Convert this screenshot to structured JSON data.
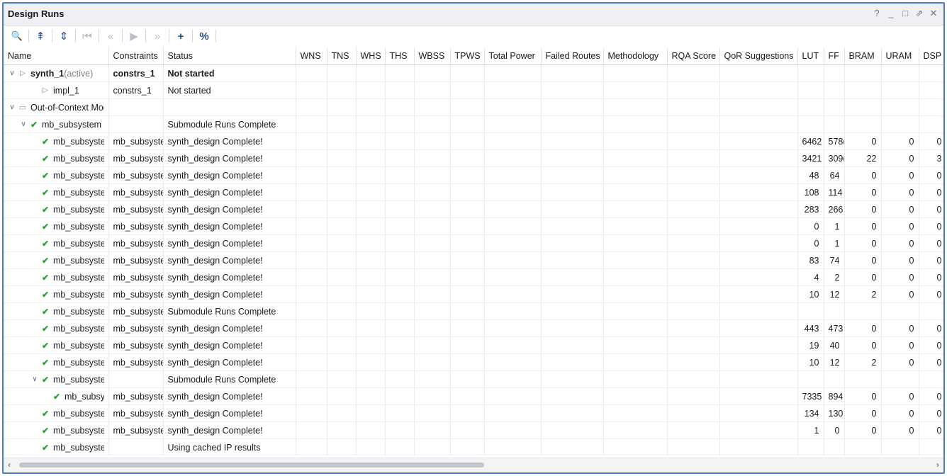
{
  "window": {
    "title": "Design Runs",
    "controls": [
      "?",
      "_",
      "□",
      "⇗",
      "✕"
    ]
  },
  "toolbar": {
    "buttons": [
      {
        "name": "search",
        "glyph": "🔍"
      },
      {
        "name": "collapse-all",
        "glyph": "⇞"
      },
      {
        "name": "expand-all",
        "glyph": "⇕"
      },
      {
        "name": "first",
        "glyph": "⏮"
      },
      {
        "name": "previous",
        "glyph": "«"
      },
      {
        "name": "run",
        "glyph": "▶"
      },
      {
        "name": "next",
        "glyph": "»"
      },
      {
        "name": "add",
        "glyph": "+"
      },
      {
        "name": "percent",
        "glyph": "%"
      }
    ]
  },
  "columns": [
    "Name",
    "Constraints",
    "Status",
    "WNS",
    "TNS",
    "WHS",
    "THS",
    "WBSS",
    "TPWS",
    "Total Power",
    "Failed Routes",
    "Methodology",
    "RQA Score",
    "QoR Suggestions",
    "LUT",
    "FF",
    "BRAM",
    "URAM",
    "DSP"
  ],
  "rows": [
    {
      "indent": 0,
      "exp": "∨",
      "icon": "play",
      "name": "synth_1",
      "suffix": " (active)",
      "constraints": "constrs_1",
      "status": "Not started",
      "bold": true,
      "lut": "",
      "ff": "",
      "bram": "",
      "uram": "",
      "dsp": ""
    },
    {
      "indent": 2,
      "exp": "",
      "icon": "play",
      "name": "impl_1",
      "suffix": "",
      "constraints": "constrs_1",
      "status": "Not started",
      "bold": false,
      "lut": "",
      "ff": "",
      "bram": "",
      "uram": "",
      "dsp": ""
    },
    {
      "indent": 0,
      "exp": "∨",
      "icon": "folder",
      "name": "Out-of-Context Module Runs",
      "suffix": "",
      "constraints": "",
      "status": "",
      "bold": false,
      "lut": "",
      "ff": "",
      "bram": "",
      "uram": "",
      "dsp": ""
    },
    {
      "indent": 1,
      "exp": "∨",
      "icon": "check",
      "name": "mb_subsystem",
      "suffix": "",
      "constraints": "",
      "status": "Submodule Runs Complete",
      "bold": false,
      "lut": "",
      "ff": "",
      "bram": "",
      "uram": "",
      "dsp": ""
    },
    {
      "indent": 2,
      "exp": "",
      "icon": "check",
      "name": "mb_subsystem",
      "suffix": "",
      "constraints": "mb_subsyste",
      "status": "synth_design Complete!",
      "bold": false,
      "lut": "6462",
      "ff": "578(",
      "bram": "0",
      "uram": "0",
      "dsp": "0"
    },
    {
      "indent": 2,
      "exp": "",
      "icon": "check",
      "name": "mb_subsystem",
      "suffix": "",
      "constraints": "mb_subsyste",
      "status": "synth_design Complete!",
      "bold": false,
      "lut": "3421",
      "ff": "309(",
      "bram": "22",
      "uram": "0",
      "dsp": "3"
    },
    {
      "indent": 2,
      "exp": "",
      "icon": "check",
      "name": "mb_subsystem",
      "suffix": "",
      "constraints": "mb_subsyste",
      "status": "synth_design Complete!",
      "bold": false,
      "lut": "48",
      "ff": "64",
      "bram": "0",
      "uram": "0",
      "dsp": "0"
    },
    {
      "indent": 2,
      "exp": "",
      "icon": "check",
      "name": "mb_subsystem",
      "suffix": "",
      "constraints": "mb_subsyste",
      "status": "synth_design Complete!",
      "bold": false,
      "lut": "108",
      "ff": "114",
      "bram": "0",
      "uram": "0",
      "dsp": "0"
    },
    {
      "indent": 2,
      "exp": "",
      "icon": "check",
      "name": "mb_subsystem",
      "suffix": "",
      "constraints": "mb_subsyste",
      "status": "synth_design Complete!",
      "bold": false,
      "lut": "283",
      "ff": "266",
      "bram": "0",
      "uram": "0",
      "dsp": "0"
    },
    {
      "indent": 2,
      "exp": "",
      "icon": "check",
      "name": "mb_subsystem",
      "suffix": "",
      "constraints": "mb_subsyste",
      "status": "synth_design Complete!",
      "bold": false,
      "lut": "0",
      "ff": "1",
      "bram": "0",
      "uram": "0",
      "dsp": "0"
    },
    {
      "indent": 2,
      "exp": "",
      "icon": "check",
      "name": "mb_subsystem",
      "suffix": "",
      "constraints": "mb_subsyste",
      "status": "synth_design Complete!",
      "bold": false,
      "lut": "0",
      "ff": "1",
      "bram": "0",
      "uram": "0",
      "dsp": "0"
    },
    {
      "indent": 2,
      "exp": "",
      "icon": "check",
      "name": "mb_subsystem",
      "suffix": "",
      "constraints": "mb_subsyste",
      "status": "synth_design Complete!",
      "bold": false,
      "lut": "83",
      "ff": "74",
      "bram": "0",
      "uram": "0",
      "dsp": "0"
    },
    {
      "indent": 2,
      "exp": "",
      "icon": "check",
      "name": "mb_subsystem",
      "suffix": "",
      "constraints": "mb_subsyste",
      "status": "synth_design Complete!",
      "bold": false,
      "lut": "4",
      "ff": "2",
      "bram": "0",
      "uram": "0",
      "dsp": "0"
    },
    {
      "indent": 2,
      "exp": "",
      "icon": "check",
      "name": "mb_subsystem",
      "suffix": "",
      "constraints": "mb_subsyste",
      "status": "synth_design Complete!",
      "bold": false,
      "lut": "10",
      "ff": "12",
      "bram": "2",
      "uram": "0",
      "dsp": "0"
    },
    {
      "indent": 2,
      "exp": "",
      "icon": "check",
      "name": "mb_subsystem",
      "suffix": "",
      "constraints": "mb_subsyste",
      "status": "Submodule Runs Complete",
      "bold": false,
      "lut": "",
      "ff": "",
      "bram": "",
      "uram": "",
      "dsp": ""
    },
    {
      "indent": 2,
      "exp": "",
      "icon": "check",
      "name": "mb_subsystem",
      "suffix": "",
      "constraints": "mb_subsyste",
      "status": "synth_design Complete!",
      "bold": false,
      "lut": "443",
      "ff": "473",
      "bram": "0",
      "uram": "0",
      "dsp": "0"
    },
    {
      "indent": 2,
      "exp": "",
      "icon": "check",
      "name": "mb_subsystem",
      "suffix": "",
      "constraints": "mb_subsyste",
      "status": "synth_design Complete!",
      "bold": false,
      "lut": "19",
      "ff": "40",
      "bram": "0",
      "uram": "0",
      "dsp": "0"
    },
    {
      "indent": 2,
      "exp": "",
      "icon": "check",
      "name": "mb_subsystem",
      "suffix": "",
      "constraints": "mb_subsyste",
      "status": "synth_design Complete!",
      "bold": false,
      "lut": "10",
      "ff": "12",
      "bram": "2",
      "uram": "0",
      "dsp": "0"
    },
    {
      "indent": 2,
      "exp": "∨",
      "icon": "check",
      "name": "mb_subsystem",
      "suffix": "",
      "constraints": "",
      "status": "Submodule Runs Complete",
      "bold": false,
      "lut": "",
      "ff": "",
      "bram": "",
      "uram": "",
      "dsp": ""
    },
    {
      "indent": 3,
      "exp": "",
      "icon": "check",
      "name": "mb_subsys",
      "suffix": "",
      "constraints": "mb_subsyste",
      "status": "synth_design Complete!",
      "bold": false,
      "lut": "7335",
      "ff": "894",
      "bram": "0",
      "uram": "0",
      "dsp": "0"
    },
    {
      "indent": 2,
      "exp": "",
      "icon": "check",
      "name": "mb_subsystem",
      "suffix": "",
      "constraints": "mb_subsyste",
      "status": "synth_design Complete!",
      "bold": false,
      "lut": "134",
      "ff": "130",
      "bram": "0",
      "uram": "0",
      "dsp": "0"
    },
    {
      "indent": 2,
      "exp": "",
      "icon": "check",
      "name": "mb_subsystem",
      "suffix": "",
      "constraints": "mb_subsyste",
      "status": "synth_design Complete!",
      "bold": false,
      "lut": "1",
      "ff": "0",
      "bram": "0",
      "uram": "0",
      "dsp": "0"
    },
    {
      "indent": 2,
      "exp": "",
      "icon": "check",
      "name": "mb_subsystem",
      "suffix": "",
      "constraints": "",
      "status": "Using cached IP results",
      "bold": false,
      "lut": "",
      "ff": "",
      "bram": "",
      "uram": "",
      "dsp": ""
    }
  ],
  "scrollbar": {
    "left": "‹",
    "right": "›"
  }
}
